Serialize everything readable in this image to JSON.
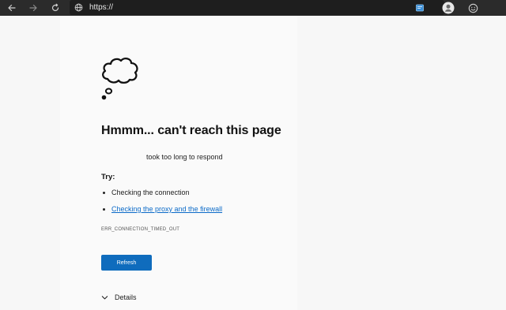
{
  "toolbar": {
    "address": "https://",
    "icons": [
      "back-arrow-icon",
      "forward-arrow-icon",
      "refresh-icon",
      "globe-icon",
      "collections-icon",
      "profile-icon",
      "feedback-smiley-icon"
    ]
  },
  "error_page": {
    "title": "Hmmm... can't reach this page",
    "subtitle": "took too long to respond",
    "try_label": "Try:",
    "suggestions": [
      {
        "text": "Checking the connection",
        "is_link": false
      },
      {
        "text": "Checking the proxy and the firewall",
        "is_link": true
      }
    ],
    "error_code": "ERR_CONNECTION_TIMED_OUT",
    "refresh_label": "Refresh",
    "details_label": "Details"
  },
  "colors": {
    "toolbar_bg": "#2b2b2b",
    "page_bg": "#f7f7f7",
    "link": "#0b6ac8",
    "button": "#0f6cbd"
  }
}
